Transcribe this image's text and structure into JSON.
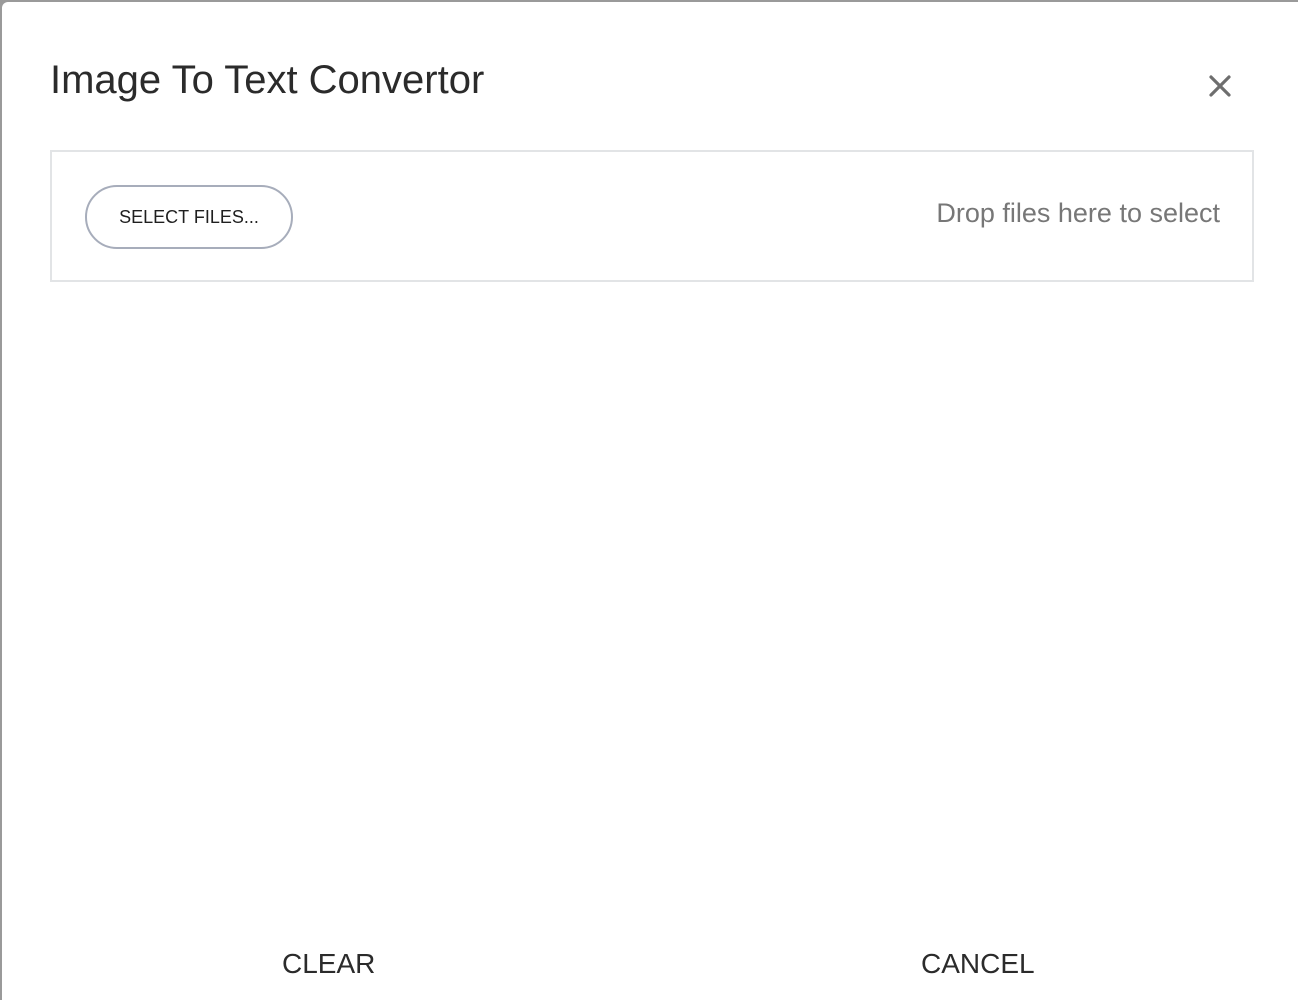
{
  "dialog": {
    "title": "Image To Text Convertor",
    "close_icon": "close-icon"
  },
  "upload": {
    "select_label": "SELECT FILES...",
    "drop_hint": "Drop files here to select"
  },
  "footer": {
    "clear_label": "CLEAR",
    "cancel_label": "CANCEL"
  },
  "colors": {
    "text": "#2b2b2b",
    "hint": "#777777",
    "button_border": "#a7adbb",
    "zone_border": "#e2e4e6"
  }
}
